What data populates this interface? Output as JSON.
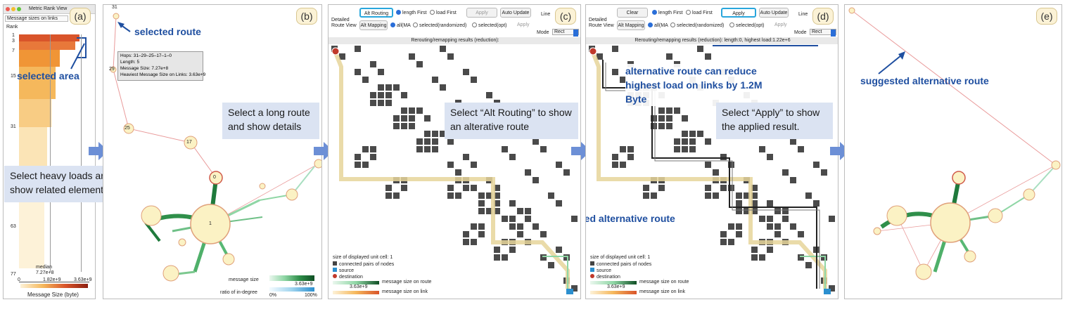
{
  "panels": {
    "a": {
      "label": "(a)",
      "window_title": "Metric Rank View",
      "dropdown": "Message sizes on links",
      "rank_header": "Rank",
      "rank_ticks": [
        "1",
        "3",
        "7",
        "15",
        "31",
        "63",
        "77"
      ],
      "median_label": "median",
      "median_value": "7.27e+8",
      "axis_ticks": [
        "0",
        "1.82e+9",
        "3.63e+9"
      ],
      "axis_title": "Message Size (byte)",
      "annotation": "selected area",
      "callout": "Select heavy loads  and show related elements"
    },
    "b": {
      "label": "(b)",
      "node_top": "31",
      "annotation": "selected route",
      "tooltip": [
        "Hops: 31–29–25–17–1–0",
        "Length: 5",
        "Message Size: 7.27e+8",
        "Heaviest Message Size on Links: 3.63e+9"
      ],
      "node_labels": [
        "29",
        "25",
        "17",
        "0",
        "1"
      ],
      "legend_row1": "message size",
      "legend_val1": "3.63e+9",
      "legend_row2": "ratio of in-degree",
      "legend_min": "0%",
      "legend_max": "100%",
      "callout": "Select a long route and show details"
    },
    "c": {
      "label": "(c)",
      "btn_alt_routing": "Alt Routing",
      "opt_length_first": "length First",
      "opt_load_first": "load First",
      "btn_apply": "Apply",
      "btn_auto_update": "Auto Update",
      "line_label": "Line",
      "route_view_label": "Detailed Route View",
      "btn_alt_mapping": "Alt Mapping",
      "opt_all": "all(MA",
      "opt_selected_random": "selected(randomized)",
      "opt_selected_opt": "selected(opt)",
      "btn_apply2": "Apply",
      "mode_label": "Mode",
      "mode_value": "Rect",
      "results_bar": "Rerouting/remapping results (reduction):",
      "legend": [
        "size of displayed unit cell: 1",
        "connected pairs of nodes",
        "source",
        "destination",
        "message size on route",
        "message size on link"
      ],
      "legend_val": "3.63e+9",
      "callout": "Select “Alt Routing” to show an alterative route"
    },
    "d": {
      "label": "(d)",
      "btn_clear": "Clear",
      "opt_length_first": "length First",
      "opt_load_first": "load First",
      "btn_apply": "Apply",
      "btn_auto_update": "Auto Update",
      "line_label": "Line",
      "route_view_label": "Detailed Route View",
      "btn_alt_mapping": "Alt Mapping",
      "opt_all": "all(MA",
      "opt_selected_random": "selected(randomized)",
      "opt_selected_opt": "selected(opt)",
      "btn_apply2": "Apply",
      "mode_label": "Mode",
      "mode_value": "Rect",
      "results_bar": "Rerouting/remapping results (reduction): length:0, highest load:1.22e+6",
      "annotation_top": "alternative route can reduce highest load on links by 1.2M Byte",
      "annotation_bottom": "suggested alternative route",
      "legend": [
        "size of displayed unit cell: 1",
        "connected pairs of nodes",
        "source",
        "destination",
        "message size on route",
        "message size on link"
      ],
      "legend_val": "3.63e+9",
      "callout": "Select “Apply” to show the applied result."
    },
    "e": {
      "label": "(e)",
      "annotation": "suggested alternative route"
    }
  },
  "colors": {
    "accent_blue": "#1f4fa0",
    "callout_bg": "#dbe3f2",
    "arrow": "#6c8fd6",
    "highlight": "#29a6dc",
    "green_dark": "#1f7a3c",
    "green_light": "#8fd6a5",
    "node_fill": "#fbf2c4",
    "route_tan": "#e6d59a"
  }
}
